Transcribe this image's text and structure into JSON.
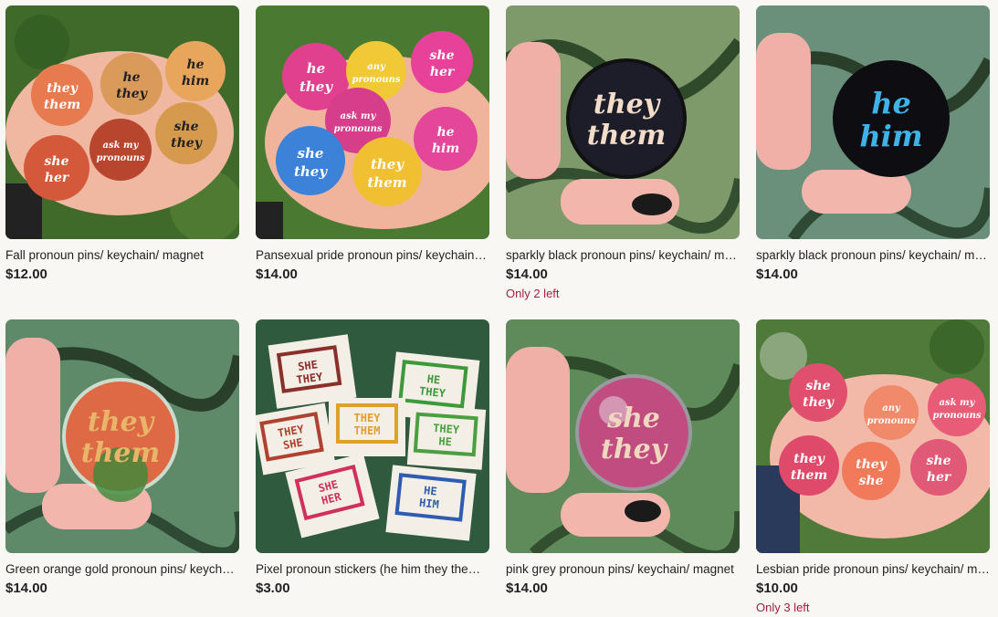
{
  "listings": [
    {
      "title": "Fall pronoun pins/ keychain/ magnet",
      "price": "$12.00",
      "stock": "",
      "image": {
        "background": "#3f6a2a",
        "pins": [
          {
            "l1": "they",
            "l2": "them",
            "color": "#e77a4f"
          },
          {
            "l1": "he",
            "l2": "they",
            "color": "#d99a5a"
          },
          {
            "l1": "he",
            "l2": "him",
            "color": "#e7a65c"
          },
          {
            "l1": "she",
            "l2": "her",
            "color": "#d4583a"
          },
          {
            "l1": "ask my",
            "l2": "pronouns",
            "color": "#b8452e"
          },
          {
            "l1": "she",
            "l2": "they",
            "color": "#d69a4e"
          }
        ]
      }
    },
    {
      "title": "Pansexual pride pronoun pins/ keychain/ magnet",
      "price": "$14.00",
      "stock": "",
      "image": {
        "background": "#4a7a32",
        "pins": [
          {
            "l1": "he",
            "l2": "they",
            "color": "#e0408e"
          },
          {
            "l1": "any",
            "l2": "pronouns",
            "color": "#f1c936"
          },
          {
            "l1": "she",
            "l2": "her",
            "color": "#e8419a"
          },
          {
            "l1": "ask my",
            "l2": "pronouns",
            "color": "#d63d8a"
          },
          {
            "l1": "she",
            "l2": "they",
            "color": "#3b82d8"
          },
          {
            "l1": "they",
            "l2": "them",
            "color": "#f0c032"
          },
          {
            "l1": "he",
            "l2": "him",
            "color": "#e4469a"
          }
        ]
      }
    },
    {
      "title": "sparkly black pronoun pins/ keychain/ magnet",
      "price": "$14.00",
      "stock": "Only 2 left",
      "image": {
        "background": "#7f9a6a",
        "pins": [
          {
            "l1": "they",
            "l2": "them",
            "color": "#111111"
          }
        ]
      }
    },
    {
      "title": "sparkly black pronoun pins/ keychain/ magnet",
      "price": "$14.00",
      "stock": "",
      "image": {
        "background": "#6a8f7a",
        "pins": [
          {
            "l1": "he",
            "l2": "him",
            "color": "#0d0d12"
          }
        ]
      }
    },
    {
      "title": "Green orange gold pronoun pins/ keychain/ magnet",
      "price": "$14.00",
      "stock": "",
      "image": {
        "background": "#5e8a6a",
        "pins": [
          {
            "l1": "they",
            "l2": "them",
            "color": "#e2552d"
          }
        ]
      }
    },
    {
      "title": "Pixel pronoun stickers (he him they them she her)",
      "price": "$3.00",
      "stock": "",
      "image": {
        "background": "#2f5a3e",
        "stickers": [
          {
            "l1": "SHE",
            "l2": "THEY",
            "color": "#8a2f2a"
          },
          {
            "l1": "HE",
            "l2": "THEY",
            "color": "#3d9a3a"
          },
          {
            "l1": "THEY",
            "l2": "SHE",
            "color": "#b0402f"
          },
          {
            "l1": "THEY",
            "l2": "THEM",
            "color": "#e0a12a"
          },
          {
            "l1": "THEY",
            "l2": "HE",
            "color": "#4aa040"
          },
          {
            "l1": "SHE",
            "l2": "HER",
            "color": "#d0305a"
          },
          {
            "l1": "HE",
            "l2": "HIM",
            "color": "#2f5cb0"
          }
        ]
      }
    },
    {
      "title": "pink grey pronoun pins/ keychain/ magnet",
      "price": "$14.00",
      "stock": "",
      "image": {
        "background": "#5f8a5a",
        "pins": [
          {
            "l1": "she",
            "l2": "they",
            "color": "#c8407a"
          }
        ]
      }
    },
    {
      "title": "Lesbian pride pronoun pins/ keychain/ magnet",
      "price": "$10.00",
      "stock": "Only 3 left",
      "image": {
        "background": "#4f7a3a",
        "pins": [
          {
            "l1": "she",
            "l2": "they",
            "color": "#e0506e"
          },
          {
            "l1": "any",
            "l2": "pronouns",
            "color": "#f08a6a"
          },
          {
            "l1": "ask my",
            "l2": "pronouns",
            "color": "#e85c78"
          },
          {
            "l1": "they",
            "l2": "them",
            "color": "#e04a6a"
          },
          {
            "l1": "they",
            "l2": "she",
            "color": "#f07a5a"
          },
          {
            "l1": "she",
            "l2": "her",
            "color": "#e05a78"
          }
        ]
      }
    }
  ]
}
